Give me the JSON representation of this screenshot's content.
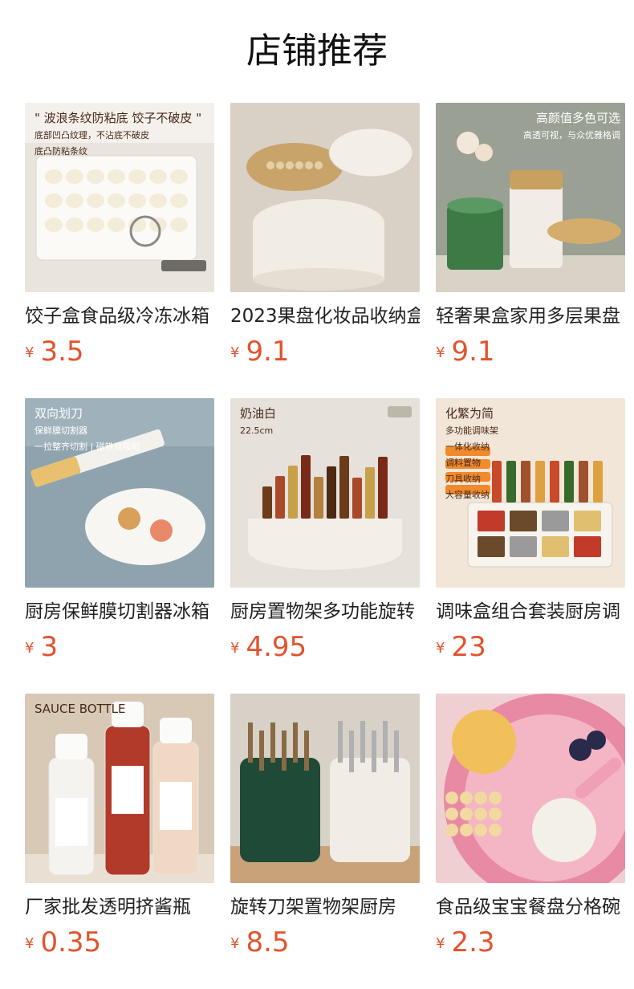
{
  "page": {
    "title": "店铺推荐"
  },
  "products": [
    {
      "name": "饺子盒食品级冷冻冰箱",
      "currency": "¥",
      "price": "3.5",
      "thumb": {
        "bg": "#e9e4de",
        "accent": "#f2efe9",
        "icon": "dumpling-box-image",
        "lines": [
          "\" 波浪条纹防粘底 饺子不破皮 \"",
          "底部凹凸纹理，不沾底不破皮",
          "底凸防粘条纹"
        ]
      }
    },
    {
      "name": "2023果盘化妆品收纳盒",
      "currency": "¥",
      "price": "9.1",
      "thumb": {
        "bg": "#d9d1c6",
        "accent": "#c9a46a",
        "icon": "jewelry-organizer-image",
        "lines": []
      }
    },
    {
      "name": "轻奢果盒家用多层果盘",
      "currency": "¥",
      "price": "9.1",
      "thumb": {
        "bg": "#9aa093",
        "accent": "#3e7a46",
        "icon": "fruit-box-image",
        "lines": [
          "高颜值多色可选",
          "高透可视，与众优雅格调"
        ]
      }
    },
    {
      "name": "厨房保鲜膜切割器冰箱",
      "currency": "¥",
      "price": "3",
      "thumb": {
        "bg": "#8ea3ae",
        "accent": "#e8c070",
        "icon": "wrap-cutter-image",
        "lines": [
          "双向划刀",
          "保鲜膜切割器",
          "一拉整齐切割 | 磁铁双吸附"
        ]
      }
    },
    {
      "name": "厨房置物架多功能旋转",
      "currency": "¥",
      "price": "4.95",
      "thumb": {
        "bg": "#e6e1da",
        "accent": "#a0582c",
        "icon": "rotating-spice-rack-image",
        "lines": [
          "奶油白",
          "22.5cm"
        ]
      }
    },
    {
      "name": "调味盒组合套装厨房调",
      "currency": "¥",
      "price": "23",
      "thumb": {
        "bg": "#f1e6d8",
        "accent": "#f08a2c",
        "icon": "seasoning-box-image",
        "lines": [
          "化繁为简",
          "多功能调味架",
          "一体化收纳",
          "调料置物",
          "刀具收纳",
          "大容量收纳"
        ]
      }
    },
    {
      "name": "厂家批发透明挤酱瓶",
      "currency": "¥",
      "price": "0.35",
      "thumb": {
        "bg": "#d8c8b6",
        "accent": "#b23a2a",
        "icon": "sauce-bottle-image",
        "lines": [
          "SAUCE BOTTLE"
        ]
      }
    },
    {
      "name": "旋转刀架置物架厨房",
      "currency": "¥",
      "price": "8.5",
      "thumb": {
        "bg": "#d7d1c8",
        "accent": "#1f4a37",
        "icon": "knife-holder-image",
        "lines": []
      }
    },
    {
      "name": "食品级宝宝餐盘分格碗",
      "currency": "¥",
      "price": "2.3",
      "thumb": {
        "bg": "#f0cfd3",
        "accent": "#e88aa4",
        "icon": "baby-plate-image",
        "lines": []
      }
    }
  ]
}
